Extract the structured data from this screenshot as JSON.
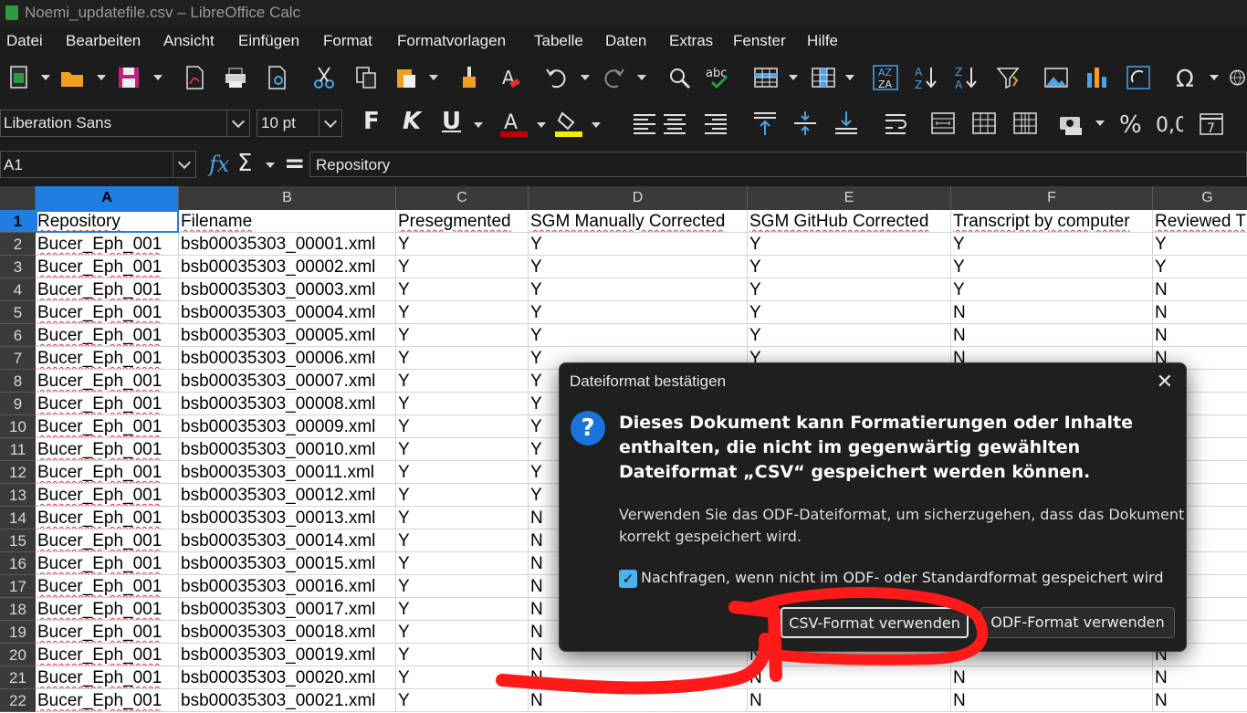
{
  "window": {
    "title": "Noemi_updatefile.csv – LibreOffice Calc"
  },
  "menu": [
    "Datei",
    "Bearbeiten",
    "Ansicht",
    "Einfügen",
    "Format",
    "Formatvorlagen",
    "Tabelle",
    "Daten",
    "Extras",
    "Fenster",
    "Hilfe"
  ],
  "font": {
    "name": "Liberation Sans",
    "size": "10 pt"
  },
  "formula": {
    "cell_ref": "A1",
    "content": "Repository"
  },
  "columns": [
    "A",
    "B",
    "C",
    "D",
    "E",
    "F",
    "G"
  ],
  "rows": [
    [
      "Repository",
      "Filename",
      "Presegmented",
      "SGM Manually Corrected",
      "SGM GitHub Corrected",
      "Transcript by computer",
      "Reviewed T"
    ],
    [
      "Bucer_Eph_001",
      "bsb00035303_00001.xml",
      "Y",
      "Y",
      "Y",
      "Y",
      "Y"
    ],
    [
      "Bucer_Eph_001",
      "bsb00035303_00002.xml",
      "Y",
      "Y",
      "Y",
      "Y",
      "Y"
    ],
    [
      "Bucer_Eph_001",
      "bsb00035303_00003.xml",
      "Y",
      "Y",
      "Y",
      "Y",
      "N"
    ],
    [
      "Bucer_Eph_001",
      "bsb00035303_00004.xml",
      "Y",
      "Y",
      "Y",
      "N",
      "N"
    ],
    [
      "Bucer_Eph_001",
      "bsb00035303_00005.xml",
      "Y",
      "Y",
      "Y",
      "N",
      "N"
    ],
    [
      "Bucer_Eph_001",
      "bsb00035303_00006.xml",
      "Y",
      "Y",
      "Y",
      "N",
      "N"
    ],
    [
      "Bucer_Eph_001",
      "bsb00035303_00007.xml",
      "Y",
      "Y",
      "",
      "",
      ""
    ],
    [
      "Bucer_Eph_001",
      "bsb00035303_00008.xml",
      "Y",
      "Y",
      "",
      "",
      ""
    ],
    [
      "Bucer_Eph_001",
      "bsb00035303_00009.xml",
      "Y",
      "Y",
      "",
      "",
      ""
    ],
    [
      "Bucer_Eph_001",
      "bsb00035303_00010.xml",
      "Y",
      "Y",
      "",
      "",
      ""
    ],
    [
      "Bucer_Eph_001",
      "bsb00035303_00011.xml",
      "Y",
      "Y",
      "",
      "",
      ""
    ],
    [
      "Bucer_Eph_001",
      "bsb00035303_00012.xml",
      "Y",
      "Y",
      "",
      "",
      ""
    ],
    [
      "Bucer_Eph_001",
      "bsb00035303_00013.xml",
      "Y",
      "N",
      "",
      "",
      ""
    ],
    [
      "Bucer_Eph_001",
      "bsb00035303_00014.xml",
      "Y",
      "N",
      "",
      "",
      ""
    ],
    [
      "Bucer_Eph_001",
      "bsb00035303_00015.xml",
      "Y",
      "N",
      "",
      "",
      ""
    ],
    [
      "Bucer_Eph_001",
      "bsb00035303_00016.xml",
      "Y",
      "N",
      "",
      "",
      ""
    ],
    [
      "Bucer_Eph_001",
      "bsb00035303_00017.xml",
      "Y",
      "N",
      "",
      "",
      ""
    ],
    [
      "Bucer_Eph_001",
      "bsb00035303_00018.xml",
      "Y",
      "N",
      "",
      "",
      ""
    ],
    [
      "Bucer_Eph_001",
      "bsb00035303_00019.xml",
      "Y",
      "N",
      "N",
      "",
      "N"
    ],
    [
      "Bucer_Eph_001",
      "bsb00035303_00020.xml",
      "Y",
      "N",
      "N",
      "N",
      "N"
    ],
    [
      "Bucer_Eph_001",
      "bsb00035303_00021.xml",
      "Y",
      "N",
      "N",
      "N",
      "N"
    ]
  ],
  "dialog": {
    "title": "Dateiformat bestätigen",
    "message": "Dieses Dokument kann Formatierungen oder Inhalte enthalten, die nicht im gegenwärtig gewählten Dateiformat „CSV“ gespeichert werden können.",
    "detail": "Verwenden Sie das ODF-Dateiformat, um sicherzugehen, dass das Dokument korrekt gespeichert wird.",
    "checkbox_label": "Nachfragen, wenn nicht im ODF- oder Standardformat gespeichert wird",
    "checkbox_checked": true,
    "button_csv": "CSV-Format verwenden",
    "button_odf": "ODF-Format verwenden",
    "close_glyph": "✕",
    "icon_glyph": "?"
  },
  "colors": {
    "selection": "#1f7ee0",
    "annotation": "#ff1a1a",
    "dialog_bg": "#1f1f1f"
  }
}
